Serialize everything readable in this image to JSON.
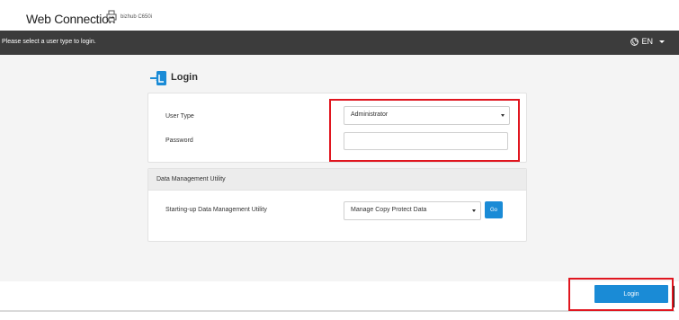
{
  "header": {
    "app_title": "Web Connection",
    "model": "bizhub C650i"
  },
  "topbar": {
    "message": "Please select a user type to login.",
    "language": "EN",
    "language_icon": "globe-icon"
  },
  "login": {
    "title": "Login",
    "icon": "login-icon",
    "user_type_label": "User Type",
    "user_type_value": "Administrator",
    "password_label": "Password",
    "password_value": ""
  },
  "data_management": {
    "header": "Data Management Utility",
    "label": "Starting-up Data Management Utility",
    "selected": "Manage Copy Protect Data",
    "go_label": "Go"
  },
  "footer": {
    "login_label": "Login"
  },
  "colors": {
    "topbar": "#3c3c3c",
    "accent": "#1a8bd6",
    "highlight": "#e0161f"
  }
}
